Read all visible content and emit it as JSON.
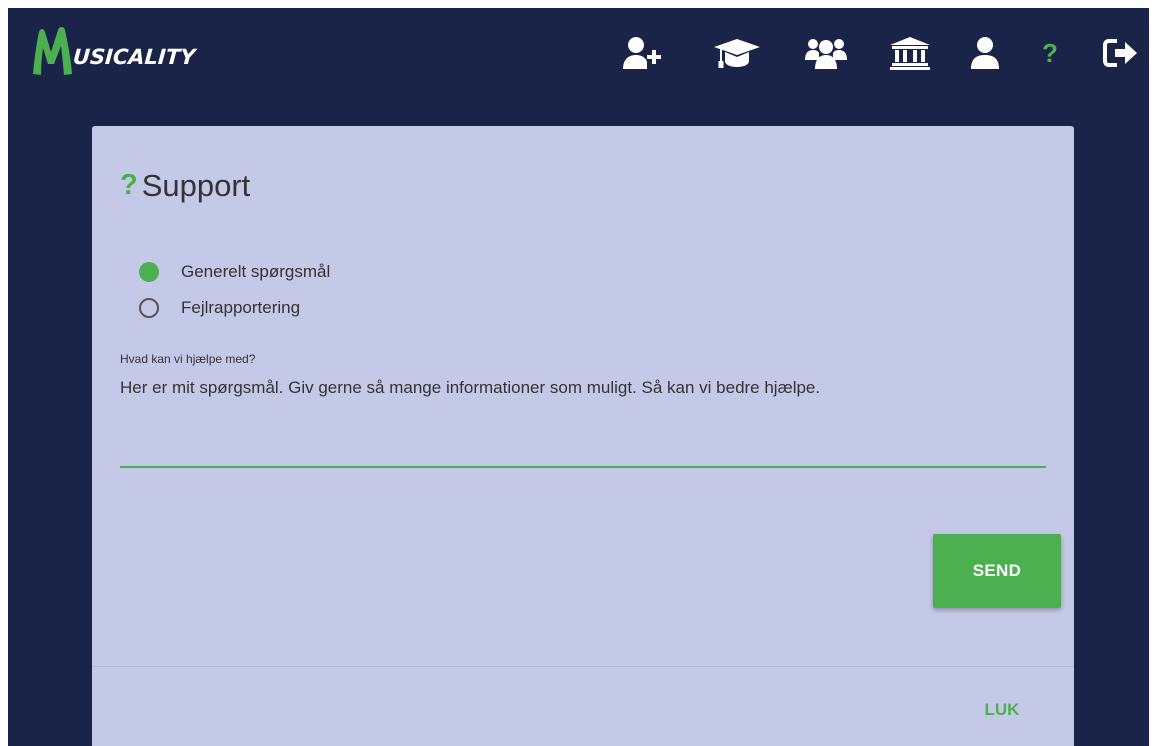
{
  "header": {
    "logo_text": "USICALITY",
    "logo_color": "#4caf50",
    "nav": [
      {
        "icon": "add-user-icon"
      },
      {
        "icon": "graduation-cap-icon"
      },
      {
        "icon": "group-icon"
      },
      {
        "icon": "institution-icon"
      },
      {
        "icon": "user-icon"
      },
      {
        "icon": "help-icon",
        "label": "?",
        "active": true
      },
      {
        "icon": "sign-out-icon"
      }
    ]
  },
  "dialog": {
    "title_icon": "?",
    "title": "Support",
    "options": [
      {
        "label": "Generelt spørgsmål",
        "selected": true
      },
      {
        "label": "Fejlrapportering",
        "selected": false
      }
    ],
    "field_label": "Hvad kan vi hjælpe med?",
    "field_value": "Her er mit spørgsmål. Giv gerne så mange informationer som muligt. Så kan vi bedre hjælpe.",
    "send_label": "SEND",
    "close_label": "LUK"
  },
  "colors": {
    "accent": "#4caf50",
    "header_bg": "#1a2448",
    "dialog_bg": "#c5c9e8"
  }
}
